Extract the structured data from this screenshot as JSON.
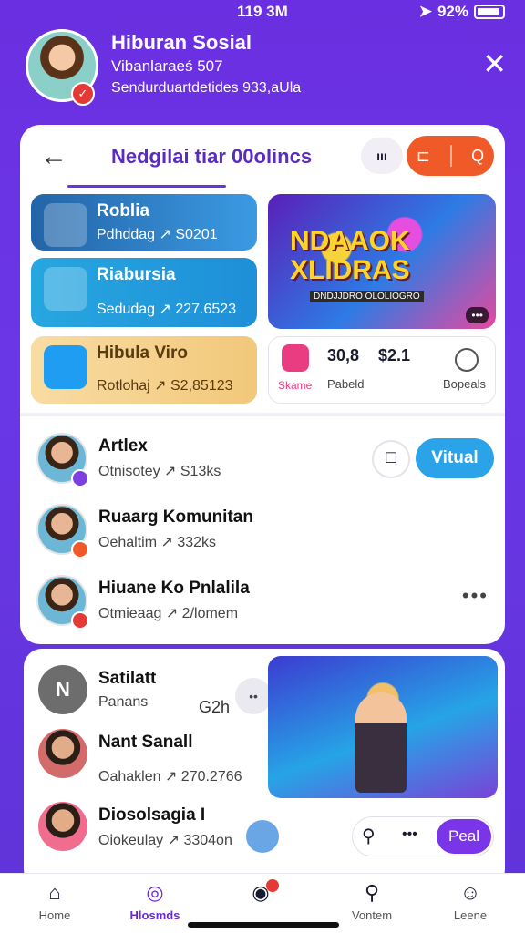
{
  "status": {
    "time": "119 3M",
    "battery": "92%"
  },
  "profile": {
    "name": "Hiburan Sosial",
    "handle": "Vibanlaraeś 507",
    "meta": "Sendurduartdetides 933,aUla"
  },
  "header": {
    "title": "Nedgilai tiar 00olincs",
    "grid_label": "ııı",
    "pill_left": "⊏",
    "pill_right": "Q"
  },
  "tiles": [
    {
      "title": "Roblia",
      "subtitle": "Pdhddag ↗ S0201"
    },
    {
      "title": "Riabursia",
      "subtitle": "Sedudag ↗ 227.6523"
    },
    {
      "title": "Hibula Viro",
      "subtitle": "Rotlohaj ↗ S2,85123"
    }
  ],
  "game": {
    "title": "NDAAOK XLIDRAS",
    "sub": "DNDJJDRO OLOLIOGRO",
    "dots": "•••"
  },
  "stats": {
    "label1": "Skame",
    "num1": "30,8",
    "label2": "Pabeld",
    "num2": "$2.1",
    "label3": "Bopeals"
  },
  "feed": [
    {
      "name": "Artlex",
      "meta": "Otnisotey ↗ S13ks"
    },
    {
      "name": "Ruaarg Komunitan",
      "meta": "Oehaltim ↗ 332ks"
    },
    {
      "name": "Hiuane Ko Pnlalila",
      "meta": "Otmieaag ↗ 2/lomem"
    }
  ],
  "follow": {
    "label": "Vitual"
  },
  "card2": {
    "rows": [
      {
        "name": "Satilatt",
        "meta": "Panans",
        "time": "G2h",
        "avatar_text": "N"
      },
      {
        "name": "Nant Sanall",
        "meta": "Oahaklen ↗ 270.2766"
      },
      {
        "name": "Diosolsagia I",
        "meta": "Oiokeulay ↗ 3304on"
      }
    ],
    "search_button": "Peal"
  },
  "nav": [
    {
      "label": "Home"
    },
    {
      "label": "Hlosmds"
    },
    {
      "label": ""
    },
    {
      "label": "Vontem"
    },
    {
      "label": "Leene"
    }
  ],
  "colors": {
    "accent": "#6c2bd9",
    "orange": "#f05a28",
    "blue": "#2aa3e8"
  }
}
